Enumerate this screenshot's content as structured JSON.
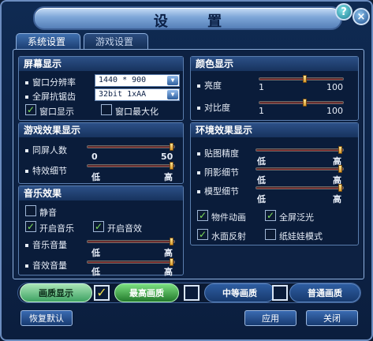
{
  "window": {
    "title": "设 置"
  },
  "tabs": [
    {
      "label": "系统设置",
      "active": true
    },
    {
      "label": "游戏设置",
      "active": false
    }
  ],
  "screen_display": {
    "header": "屏幕显示",
    "resolution_label": "窗口分辨率",
    "resolution_value": "1440 * 900",
    "antialias_label": "全屏抗锯齿",
    "antialias_value": "32bit 1xAA",
    "window_mode_label": "窗口显示",
    "window_mode_checked": true,
    "maximize_label": "窗口最大化",
    "maximize_checked": false
  },
  "color_display": {
    "header": "颜色显示",
    "brightness_label": "亮度",
    "brightness_min": "1",
    "brightness_max": "100",
    "brightness_value": 0.55,
    "contrast_label": "对比度",
    "contrast_min": "1",
    "contrast_max": "100",
    "contrast_value": 0.55
  },
  "game_effects": {
    "header": "游戏效果显示",
    "players_label": "同屏人数",
    "players_min": "0",
    "players_max": "50",
    "players_value": 1.0,
    "effects_label": "特效细节",
    "effects_min": "低",
    "effects_max": "高",
    "effects_value": 1.0
  },
  "environment_effects": {
    "header": "环境效果显示",
    "texture_label": "贴图精度",
    "texture_min": "低",
    "texture_max": "高",
    "texture_value": 1.0,
    "shadow_label": "阴影细节",
    "shadow_min": "低",
    "shadow_max": "高",
    "shadow_value": 1.0,
    "model_label": "模型细节",
    "model_min": "低",
    "model_max": "高",
    "model_value": 1.0,
    "anim_label": "物件动画",
    "anim_checked": true,
    "fullscreen_glow_label": "全屏泛光",
    "fullscreen_glow_checked": true,
    "water_label": "水面反射",
    "water_checked": true,
    "doll_label": "纸娃娃模式",
    "doll_checked": false
  },
  "music": {
    "header": "音乐效果",
    "mute_label": "静音",
    "mute_checked": false,
    "music_on_label": "开启音乐",
    "music_on_checked": true,
    "sfx_on_label": "开启音效",
    "sfx_on_checked": true,
    "music_volume_label": "音乐音量",
    "music_volume_min": "低",
    "music_volume_max": "高",
    "music_volume_value": 1.0,
    "sfx_volume_label": "音效音量",
    "sfx_volume_min": "低",
    "sfx_volume_max": "高",
    "sfx_volume_value": 1.0
  },
  "quality": {
    "label": "画质显示",
    "high_label": "最高画质",
    "high_checked": true,
    "mid_label": "中等画质",
    "mid_checked": false,
    "low_label": "普通画质",
    "low_checked": false
  },
  "buttons": {
    "reset": "恢复默认",
    "apply": "应用",
    "close": "关闭"
  },
  "icons": {
    "help": "help-icon",
    "close": "close-icon",
    "dropdown": "chevron-down-icon",
    "check": "checkmark-icon"
  }
}
